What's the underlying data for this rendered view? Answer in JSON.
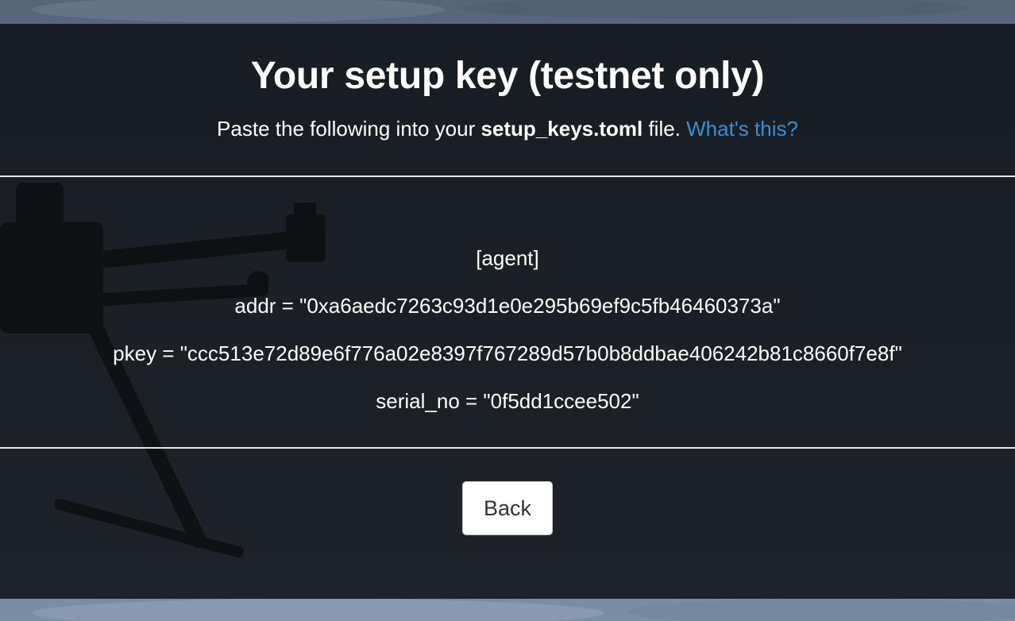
{
  "header": {
    "title": "Your setup key (testnet only)",
    "subtitle_prefix": "Paste the following into your ",
    "subtitle_filename": "setup_keys.toml",
    "subtitle_suffix": " file. ",
    "help_link_label": "What's this?"
  },
  "setup_key": {
    "section": "[agent]",
    "addr_line": "addr = \"0xa6aedc7263c93d1e0e295b69ef9c5fb46460373a\"",
    "pkey_line": "pkey = \"ccc513e72d89e6f776a02e8397f767289d57b0b8ddbae406242b81c8660f7e8f\"",
    "serial_line": "serial_no = \"0f5dd1ccee502\""
  },
  "actions": {
    "back_label": "Back"
  },
  "colors": {
    "panel_background": "#0e1115",
    "link": "#3a8fd6",
    "text": "#ffffff",
    "button_text": "#333333"
  }
}
